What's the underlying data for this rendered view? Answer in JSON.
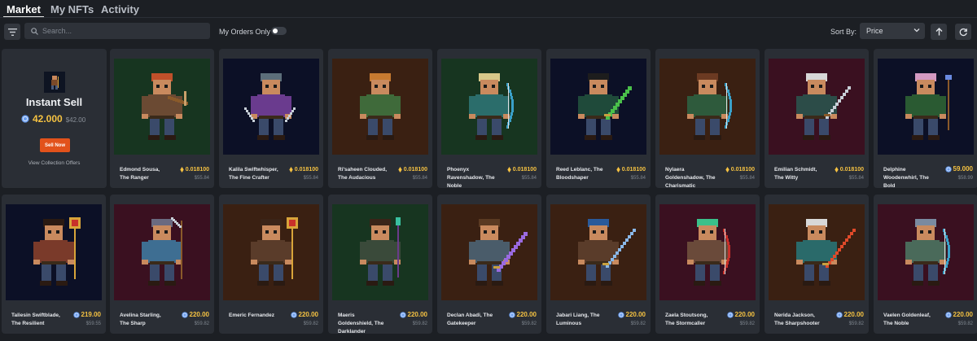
{
  "tabs": [
    {
      "label": "Market",
      "active": true
    },
    {
      "label": "My NFTs",
      "active": false
    },
    {
      "label": "Activity",
      "active": false
    }
  ],
  "toolbar": {
    "search_placeholder": "Search...",
    "my_orders_label": "My Orders Only",
    "my_orders_on": false,
    "sort_label": "Sort By:",
    "sort_value": "Price",
    "sort_direction": "ascending"
  },
  "instant_sell": {
    "title": "Instant Sell",
    "price": "42.000",
    "usd": "$42.00",
    "button_label": "Sell Now",
    "offers_link": "View Collection Offers"
  },
  "colors": {
    "price": "#f5c242",
    "sell_button": "#e2521b",
    "card_bg": "#2a2e35",
    "page_bg": "#1c1f24"
  },
  "cards": [
    {
      "name": "Edmond Sousa, The Ranger",
      "price": "0.018100",
      "usd": "$55.84",
      "currency": "eth-icon",
      "bg": "#173520",
      "hair": "#c0502a",
      "shirt": "#6b4a33",
      "weapon": "crossbow"
    },
    {
      "name": "Kalila Swiftwhisper, The Fine Crafter",
      "price": "0.018100",
      "usd": "$55.84",
      "currency": "eth-icon",
      "bg": "#0c1026",
      "hair": "#5c6e7a",
      "shirt": "#6a3b8e",
      "weapon": "blades"
    },
    {
      "name": "Ri'saheen Clouded, The Audacious",
      "price": "0.018100",
      "usd": "$55.84",
      "currency": "eth-icon",
      "bg": "#3a2012",
      "hair": "#c77a30",
      "shirt": "#3f6a3a",
      "weapon": "none"
    },
    {
      "name": "Phoenyx Ravenshadow, The Noble",
      "price": "0.018100",
      "usd": "$55.84",
      "currency": "eth-icon",
      "bg": "#173520",
      "hair": "#d8c88a",
      "shirt": "#2b6d6b",
      "weapon": "bow"
    },
    {
      "name": "Reed Leblanc, The Bloodshaper",
      "price": "0.018100",
      "usd": "$55.84",
      "currency": "eth-icon",
      "bg": "#0c1026",
      "hair": "#1d1d1d",
      "shirt": "#1f4a3a",
      "weapon": "green-sword"
    },
    {
      "name": "Nylaera Goldenshadow, The Charismatic",
      "price": "0.018100",
      "usd": "$55.84",
      "currency": "eth-icon",
      "bg": "#3a2012",
      "hair": "#6b3a22",
      "shirt": "#2e5a3c",
      "weapon": "bow"
    },
    {
      "name": "Emilian Schmidt, The Witty",
      "price": "0.018100",
      "usd": "$55.84",
      "currency": "eth-icon",
      "bg": "#3a1020",
      "hair": "#d8d8d8",
      "shirt": "#2c4c48",
      "weapon": "sword"
    },
    {
      "name": "Delphine Woodenwhirl, The Bold",
      "price": "59.000",
      "usd": "$58.99",
      "currency": "coin-icon",
      "bg": "#0c1026",
      "hair": "#d49ac2",
      "shirt": "#2a5a32",
      "weapon": "staff"
    },
    {
      "name": "Taliesin Swiftblade, The Resilient",
      "price": "219.00",
      "usd": "$59.55",
      "currency": "coin-icon",
      "bg": "#0c1026",
      "hair": "#2a1a12",
      "shirt": "#7a3a2a",
      "weapon": "golden-staff"
    },
    {
      "name": "Avelina Starling, The Sharp",
      "price": "220.00",
      "usd": "$59.82",
      "currency": "coin-icon",
      "bg": "#3a1020",
      "hair": "#6a6a80",
      "shirt": "#3e6e92",
      "weapon": "scythe"
    },
    {
      "name": "Emeric Fernandez",
      "price": "220.00",
      "usd": "$59.82",
      "currency": "coin-icon",
      "bg": "#3a2012",
      "hair": "#3a2418",
      "shirt": "#5a3c2a",
      "weapon": "golden-staff"
    },
    {
      "name": "Maeris Goldenshield, The Darklander",
      "price": "220.00",
      "usd": "$59.82",
      "currency": "coin-icon",
      "bg": "#173520",
      "hair": "#3a2418",
      "shirt": "#3a4a3a",
      "weapon": "spear"
    },
    {
      "name": "Declan Abadi, The Gatekeeper",
      "price": "220.00",
      "usd": "$59.82",
      "currency": "coin-icon",
      "bg": "#3a2012",
      "hair": "#5a3a22",
      "shirt": "#4a5c6a",
      "weapon": "purple-sword"
    },
    {
      "name": "Jabari Liang, The Luminous",
      "price": "220.00",
      "usd": "$59.82",
      "currency": "coin-icon",
      "bg": "#3a2012",
      "hair": "#2a5a9a",
      "shirt": "#5a3c2a",
      "weapon": "blue-sword"
    },
    {
      "name": "Zaela Stoutsong, The Stormcaller",
      "price": "220.00",
      "usd": "$59.82",
      "currency": "coin-icon",
      "bg": "#3a1020",
      "hair": "#3ac08a",
      "shirt": "#6a4a3a",
      "weapon": "red-bow"
    },
    {
      "name": "Nerida Jackson, The Sharpshooter",
      "price": "220.00",
      "usd": "$59.82",
      "currency": "coin-icon",
      "bg": "#3a2012",
      "hair": "#d8d8d8",
      "shirt": "#2a6a6a",
      "weapon": "red-sword"
    },
    {
      "name": "Vaelen Goldenleaf, The Noble",
      "price": "220.00",
      "usd": "$59.82",
      "currency": "coin-icon",
      "bg": "#3a1020",
      "hair": "#7a8aa0",
      "shirt": "#4a6a5a",
      "weapon": "bow"
    }
  ]
}
